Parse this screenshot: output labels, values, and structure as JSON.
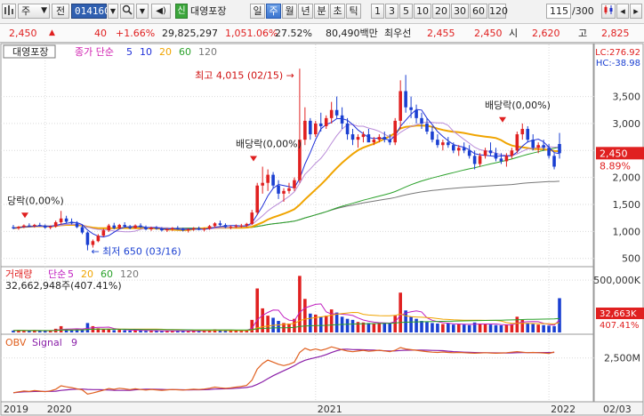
{
  "toolbar": {
    "market": "주",
    "view_mode": "전",
    "code": "014160",
    "stock_name": "대영포장",
    "credit_tag": "신",
    "periods": [
      "일",
      "주",
      "월",
      "년",
      "분",
      "초",
      "틱"
    ],
    "selected_period": "주",
    "counts": [
      "1",
      "3",
      "5",
      "10",
      "20",
      "30",
      "60",
      "120"
    ],
    "display_count": "115",
    "display_total": "/300"
  },
  "quote": {
    "price": "2,450",
    "change": "40",
    "change_pct": "+1.66%",
    "volume": "29,825,297",
    "volume_ratio": "1,051.06%",
    "turnover": "27.52%",
    "amount": "80,490백만",
    "best_ask_label": "최우선",
    "best_ask": "2,455",
    "best_bid": "2,450",
    "open_label": "시",
    "open": "2,620",
    "high_label": "고",
    "high": "2,825"
  },
  "colors": {
    "up": "#e02020",
    "down": "#1a3fd1",
    "ma5": "#1f2fd8",
    "ma20": "#f0a400",
    "ma60": "#2aa12a",
    "ma120": "#777777",
    "volume_ma5": "#c01fc0",
    "obv": "#e0601f",
    "signal": "#8a1fa8"
  },
  "icons": [
    "chart-icon",
    "search-icon",
    "dropdown-icon",
    "speaker-icon",
    "prev-icon",
    "next-icon",
    "bar-chart-icon",
    "candle-icon",
    "scroll-left-icon",
    "scroll-right-icon"
  ],
  "chart_data": {
    "type": "candlestick",
    "stock_label": "대영포장",
    "price_legend": [
      "종가 단순",
      "5",
      "10",
      "20",
      "60",
      "120"
    ],
    "lc_label": "LC:276.92",
    "hc_label": "HC:-38.98",
    "price_ticks": [
      "3,500",
      "3,000",
      "2,500",
      "2,000",
      "1,500",
      "1,000",
      "500"
    ],
    "price_ylim": [
      380,
      4300
    ],
    "last_price_tag": "2,450",
    "last_change_tag": "8.89%",
    "annotations": {
      "max_label": "최고 4,015 (02/15)",
      "min_label": "최저 650 (03/16)",
      "dividend_labels": [
        "당락(0,00%)",
        "배당락(0,00%)",
        "배당락(0,00%)"
      ]
    },
    "x_ticks": [
      "2019",
      "2020",
      "2021",
      "2022",
      "02/03"
    ],
    "volume_legend": [
      "거래량",
      "단순",
      "5",
      "20",
      "60",
      "120"
    ],
    "volume_current": "32,662,948주(407.41%)",
    "volume_ticks": [
      "500,000K"
    ],
    "volume_tag": "32,663K",
    "volume_tag_pct": "407.41%",
    "obv_legend": [
      "OBV",
      "Signal",
      "9"
    ],
    "obv_ticks": [
      "2,500M"
    ],
    "ohlc": [
      [
        1080,
        1120,
        1040,
        1060
      ],
      [
        1060,
        1100,
        1030,
        1085
      ],
      [
        1085,
        1130,
        1060,
        1110
      ],
      [
        1110,
        1150,
        1080,
        1100
      ],
      [
        1100,
        1140,
        1070,
        1120
      ],
      [
        1120,
        1160,
        1090,
        1105
      ],
      [
        1105,
        1130,
        1050,
        1070
      ],
      [
        1070,
        1110,
        1040,
        1090
      ],
      [
        1090,
        1200,
        1070,
        1170
      ],
      [
        1170,
        1380,
        1130,
        1240
      ],
      [
        1240,
        1290,
        1150,
        1180
      ],
      [
        1180,
        1240,
        1130,
        1150
      ],
      [
        1150,
        1190,
        1060,
        1080
      ],
      [
        1080,
        1120,
        950,
        980
      ],
      [
        980,
        1000,
        650,
        750
      ],
      [
        750,
        850,
        700,
        820
      ],
      [
        820,
        950,
        800,
        920
      ],
      [
        920,
        1050,
        900,
        1020
      ],
      [
        1020,
        1140,
        990,
        1110
      ],
      [
        1110,
        1160,
        1040,
        1060
      ],
      [
        1060,
        1140,
        1040,
        1120
      ],
      [
        1120,
        1170,
        1070,
        1090
      ],
      [
        1090,
        1120,
        1040,
        1060
      ],
      [
        1060,
        1130,
        1050,
        1110
      ],
      [
        1110,
        1150,
        1060,
        1080
      ],
      [
        1080,
        1110,
        1020,
        1040
      ],
      [
        1040,
        1090,
        1010,
        1070
      ],
      [
        1070,
        1100,
        1030,
        1050
      ],
      [
        1050,
        1080,
        1000,
        1020
      ],
      [
        1020,
        1060,
        990,
        1040
      ],
      [
        1040,
        1080,
        1010,
        1060
      ],
      [
        1060,
        1100,
        1030,
        1050
      ],
      [
        1050,
        1070,
        1000,
        1020
      ],
      [
        1020,
        1060,
        980,
        1040
      ],
      [
        1040,
        1080,
        1010,
        1060
      ],
      [
        1060,
        1090,
        1020,
        1030
      ],
      [
        1030,
        1070,
        1000,
        1050
      ],
      [
        1050,
        1120,
        1030,
        1100
      ],
      [
        1100,
        1170,
        1070,
        1150
      ],
      [
        1150,
        1200,
        1100,
        1120
      ],
      [
        1120,
        1150,
        1060,
        1080
      ],
      [
        1080,
        1110,
        1040,
        1090
      ],
      [
        1090,
        1130,
        1060,
        1100
      ],
      [
        1100,
        1140,
        1070,
        1110
      ],
      [
        1110,
        1160,
        1080,
        1140
      ],
      [
        1140,
        1400,
        1120,
        1350
      ],
      [
        1350,
        1900,
        1300,
        1850
      ],
      [
        1850,
        2200,
        1700,
        1900
      ],
      [
        1900,
        2150,
        1750,
        2050
      ],
      [
        2050,
        2100,
        1800,
        1850
      ],
      [
        1850,
        1950,
        1600,
        1700
      ],
      [
        1700,
        1800,
        1550,
        1750
      ],
      [
        1750,
        1900,
        1700,
        1800
      ],
      [
        1800,
        2000,
        1750,
        1950
      ],
      [
        1950,
        4015,
        1900,
        2700
      ],
      [
        2700,
        3300,
        2600,
        3050
      ],
      [
        3050,
        3100,
        2700,
        2800
      ],
      [
        2800,
        3050,
        2750,
        3000
      ],
      [
        3000,
        3200,
        2850,
        2950
      ],
      [
        2950,
        3150,
        2900,
        3100
      ],
      [
        3100,
        3400,
        3000,
        3250
      ],
      [
        3250,
        3500,
        3100,
        3150
      ],
      [
        3150,
        3300,
        2900,
        3000
      ],
      [
        3000,
        3100,
        2700,
        2800
      ],
      [
        2800,
        2900,
        2600,
        2700
      ],
      [
        2700,
        2800,
        2550,
        2750
      ],
      [
        2750,
        2850,
        2650,
        2800
      ],
      [
        2800,
        2900,
        2700,
        2650
      ],
      [
        2650,
        2750,
        2600,
        2700
      ],
      [
        2700,
        2800,
        2650,
        2750
      ],
      [
        2750,
        2850,
        2650,
        2700
      ],
      [
        2700,
        2800,
        2600,
        2650
      ],
      [
        2650,
        3100,
        2600,
        3050
      ],
      [
        3050,
        3800,
        2900,
        3600
      ],
      [
        3600,
        3900,
        3200,
        3300
      ],
      [
        3300,
        3500,
        3100,
        3250
      ],
      [
        3250,
        3350,
        3000,
        3100
      ],
      [
        3100,
        3200,
        2900,
        3000
      ],
      [
        3000,
        3100,
        2800,
        2850
      ],
      [
        2850,
        2950,
        2650,
        2700
      ],
      [
        2700,
        2800,
        2550,
        2600
      ],
      [
        2600,
        2700,
        2500,
        2650
      ],
      [
        2650,
        2750,
        2550,
        2600
      ],
      [
        2600,
        2650,
        2450,
        2500
      ],
      [
        2500,
        2600,
        2400,
        2550
      ],
      [
        2550,
        2650,
        2450,
        2500
      ],
      [
        2500,
        2600,
        2350,
        2400
      ],
      [
        2400,
        2500,
        2150,
        2250
      ],
      [
        2250,
        2450,
        2200,
        2400
      ],
      [
        2400,
        2550,
        2350,
        2500
      ],
      [
        2500,
        2650,
        2400,
        2450
      ],
      [
        2450,
        2550,
        2300,
        2350
      ],
      [
        2350,
        2450,
        2250,
        2300
      ],
      [
        2300,
        2450,
        2200,
        2400
      ],
      [
        2400,
        2550,
        2350,
        2500
      ],
      [
        2500,
        2850,
        2450,
        2800
      ],
      [
        2800,
        3000,
        2700,
        2900
      ],
      [
        2900,
        2950,
        2650,
        2700
      ],
      [
        2700,
        2800,
        2500,
        2550
      ],
      [
        2550,
        2650,
        2450,
        2600
      ],
      [
        2600,
        2700,
        2500,
        2550
      ],
      [
        2550,
        2620,
        2350,
        2400
      ],
      [
        2400,
        2450,
        2150,
        2200
      ],
      [
        2620,
        2825,
        2350,
        2450
      ]
    ],
    "volume": [
      18,
      22,
      15,
      17,
      20,
      16,
      14,
      19,
      35,
      60,
      30,
      22,
      28,
      25,
      90,
      60,
      40,
      30,
      35,
      22,
      25,
      20,
      18,
      22,
      17,
      15,
      16,
      14,
      15,
      17,
      16,
      15,
      14,
      16,
      18,
      15,
      17,
      25,
      30,
      22,
      18,
      17,
      19,
      20,
      24,
      120,
      420,
      230,
      160,
      140,
      110,
      90,
      85,
      130,
      540,
      320,
      180,
      170,
      150,
      160,
      220,
      190,
      150,
      130,
      120,
      100,
      95,
      90,
      85,
      95,
      90,
      85,
      160,
      380,
      210,
      150,
      130,
      110,
      100,
      90,
      85,
      80,
      85,
      75,
      80,
      75,
      70,
      95,
      85,
      80,
      75,
      70,
      68,
      72,
      80,
      150,
      120,
      90,
      80,
      75,
      70,
      65,
      60,
      327
    ],
    "obv_values": [
      0,
      60,
      120,
      90,
      150,
      110,
      70,
      130,
      250,
      500,
      420,
      360,
      280,
      200,
      -100,
      -20,
      80,
      180,
      300,
      240,
      320,
      270,
      220,
      280,
      230,
      190,
      230,
      200,
      170,
      200,
      230,
      210,
      190,
      220,
      250,
      230,
      260,
      320,
      400,
      350,
      310,
      350,
      400,
      450,
      520,
      900,
      1700,
      2100,
      2350,
      2200,
      2050,
      1950,
      2050,
      2200,
      2900,
      3200,
      3050,
      3150,
      3050,
      3150,
      3300,
      3200,
      3100,
      3000,
      2950,
      3000,
      3050,
      2980,
      3020,
      3060,
      3010,
      2960,
      3050,
      3250,
      3150,
      3100,
      3050,
      3000,
      2960,
      2920,
      2900,
      2930,
      2900,
      2880,
      2900,
      2880,
      2860,
      2840,
      2860,
      2880,
      2860,
      2840,
      2860,
      2880,
      2920,
      2960,
      2920,
      2880,
      2900,
      2880,
      2860,
      2830,
      2930
    ]
  }
}
